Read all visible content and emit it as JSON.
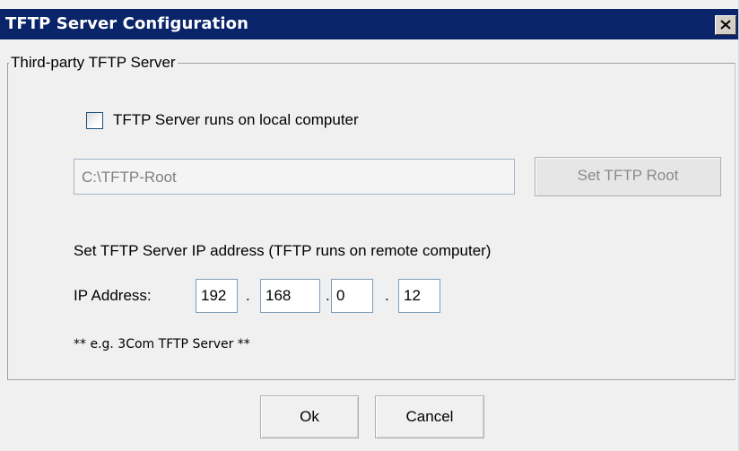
{
  "window": {
    "title": "TFTP Server Configuration"
  },
  "group": {
    "legend": "Third-party TFTP Server",
    "local_checkbox": {
      "label": "TFTP Server runs on local computer",
      "checked": false
    },
    "root_path": {
      "value": "C:\\TFTP-Root"
    },
    "set_root_label": "Set TFTP Root",
    "ip_caption": "Set TFTP Server IP address (TFTP runs on remote computer)",
    "ip_label": "IP Address:",
    "ip_octets": [
      "192",
      "168",
      "0",
      "12"
    ],
    "ip_separator": ".",
    "note": "** e.g. 3Com TFTP Server **"
  },
  "buttons": {
    "ok": "Ok",
    "cancel": "Cancel"
  }
}
